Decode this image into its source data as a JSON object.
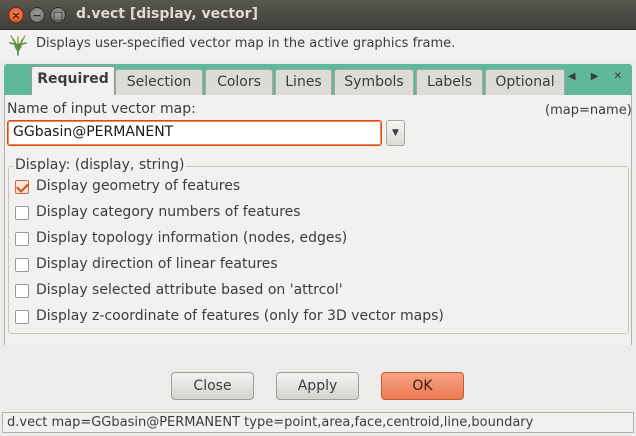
{
  "window": {
    "title": "d.vect [display, vector]",
    "close_glyph": "×",
    "minimize_glyph": "−",
    "maximize_glyph": "□"
  },
  "header": {
    "description": "Displays user-specified vector map in the active graphics frame.",
    "logo_icon": "grass-logo-icon"
  },
  "tabs": [
    {
      "label": "Required",
      "active": true
    },
    {
      "label": "Selection",
      "active": false
    },
    {
      "label": "Colors",
      "active": false
    },
    {
      "label": "Lines",
      "active": false
    },
    {
      "label": "Symbols",
      "active": false
    },
    {
      "label": "Labels",
      "active": false
    },
    {
      "label": "Optional",
      "active": false
    }
  ],
  "tab_arrows": "◀ ▶ ✕",
  "map_input": {
    "label": "Name of input vector map:",
    "param_hint": "(map=name)",
    "value": "GGbasin@PERMANENT",
    "dropdown_glyph": "▼"
  },
  "display_group": {
    "title": "Display: (display, string)",
    "options": [
      {
        "label": "Display geometry of features",
        "checked": true
      },
      {
        "label": "Display category numbers of features",
        "checked": false
      },
      {
        "label": "Display topology information (nodes, edges)",
        "checked": false
      },
      {
        "label": "Display direction of linear features",
        "checked": false
      },
      {
        "label": "Display selected attribute based on 'attrcol'",
        "checked": false
      },
      {
        "label": "Display z-coordinate of features (only for 3D vector maps)",
        "checked": false
      }
    ]
  },
  "buttons": {
    "close_label": "Close",
    "apply_label": "Apply",
    "ok_label": "OK"
  },
  "statusbar": {
    "command": "d.vect map=GGbasin@PERMANENT type=point,area,face,centroid,line,boundary"
  },
  "colors": {
    "accent": "#dd4814",
    "tab_strip": "#5fb89b",
    "titlebar": "#403f3a"
  }
}
